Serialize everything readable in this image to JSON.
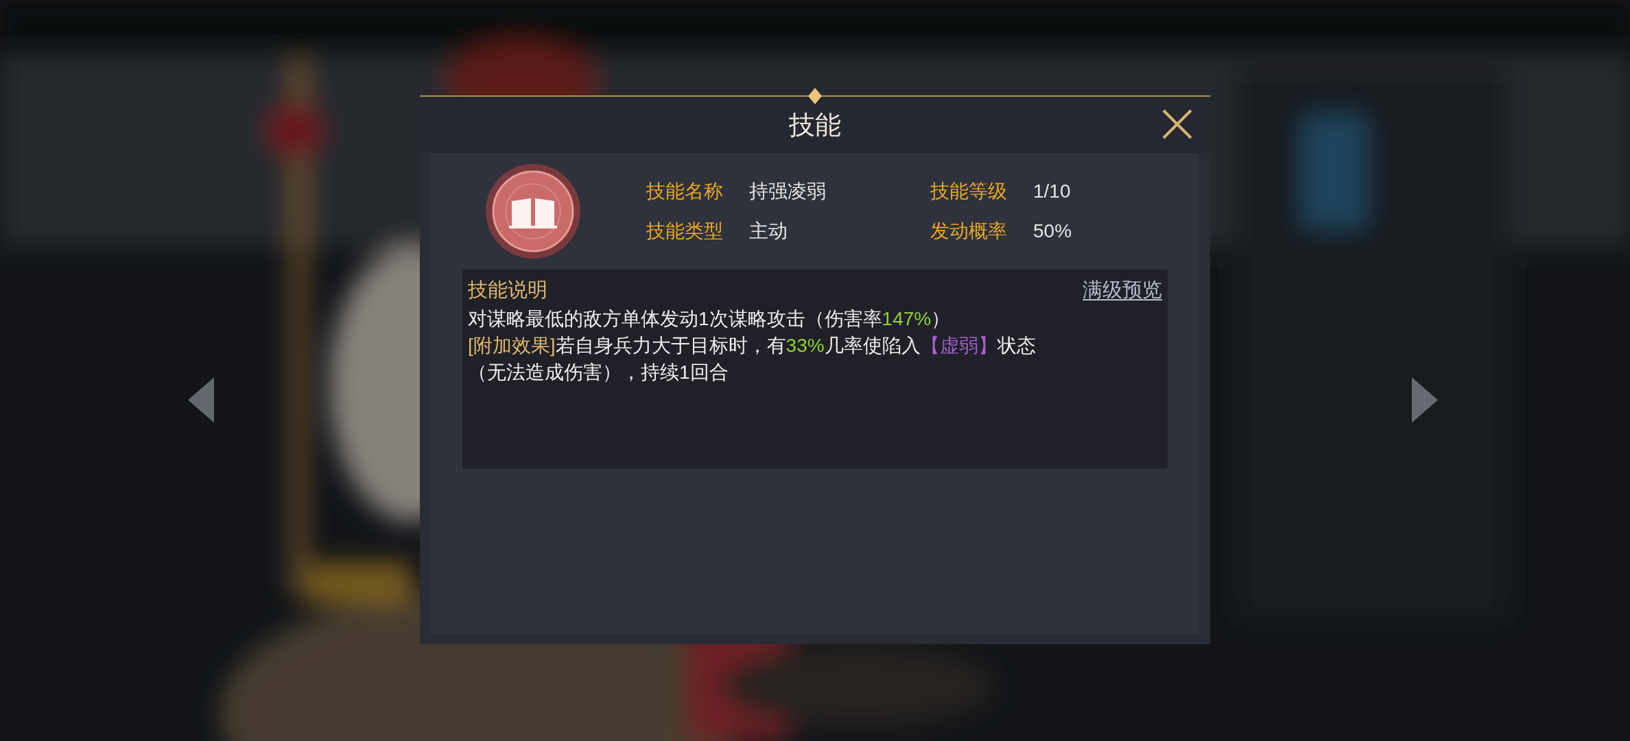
{
  "dialog": {
    "title": "技能",
    "skill": {
      "fields": [
        {
          "label": "技能名称",
          "value": "持强凌弱"
        },
        {
          "label": "技能等级",
          "value": "1/10"
        },
        {
          "label": "技能类型",
          "value": "主动"
        },
        {
          "label": "发动概率",
          "value": "50%"
        }
      ]
    },
    "description": {
      "heading": "技能说明",
      "link": "满级预览",
      "lines": [
        [
          {
            "kind": "plain",
            "text": "对谋略最低的敌方单体发动1次谋略攻击（伤害率"
          },
          {
            "kind": "number",
            "text": "147%"
          },
          {
            "kind": "plain",
            "text": "）"
          }
        ],
        [
          {
            "kind": "tag",
            "text": "[附加效果]"
          },
          {
            "kind": "plain",
            "text": "若自身兵力大于目标时，有"
          },
          {
            "kind": "number",
            "text": "33%"
          },
          {
            "kind": "plain",
            "text": "几率使陷入"
          },
          {
            "kind": "status",
            "text": "【虚弱】"
          },
          {
            "kind": "plain",
            "text": "状态"
          }
        ],
        [
          {
            "kind": "plain",
            "text": "（无法造成伤害），持续1回合"
          }
        ]
      ]
    }
  }
}
